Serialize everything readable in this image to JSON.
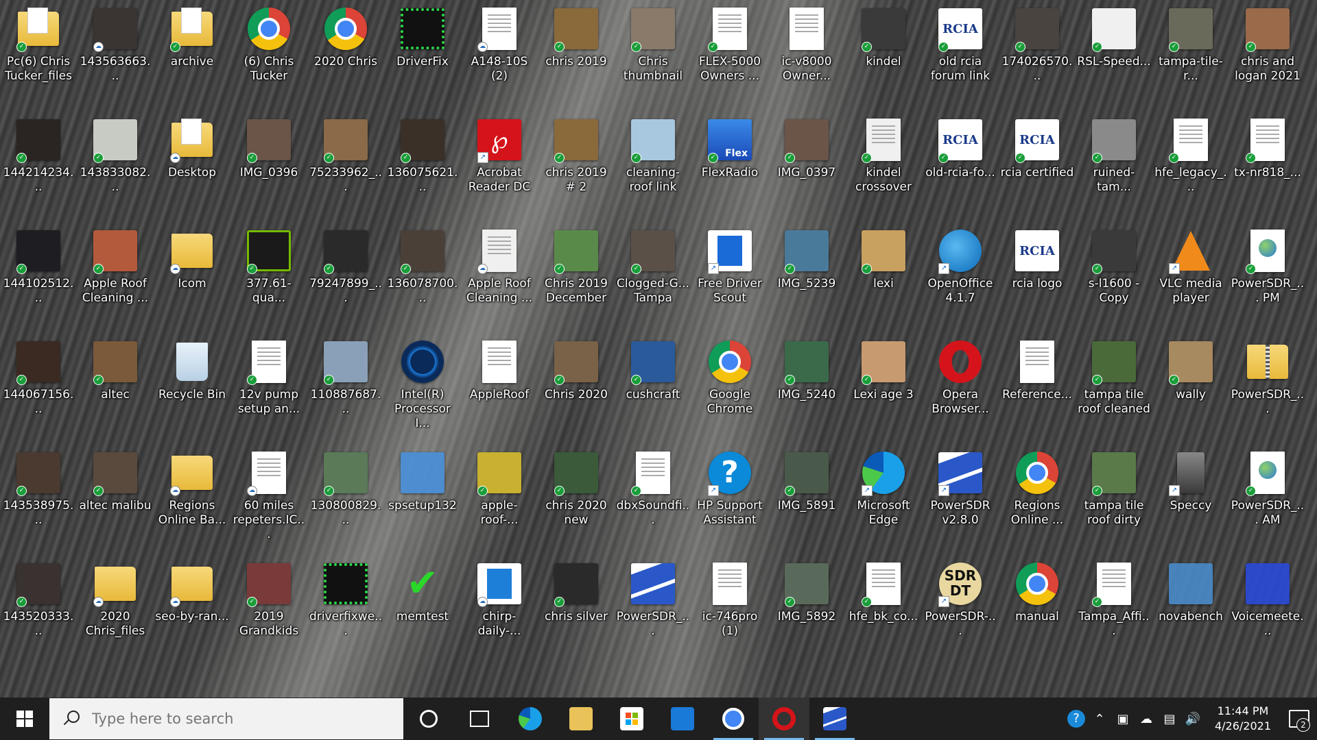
{
  "colors": {
    "taskbar": "#1f1f1f",
    "search_bg": "#f2f2f2",
    "sync_green": "#1a9e3a",
    "active_indicator": "#76b9ed"
  },
  "desktop": {
    "icons": [
      {
        "label": "Pc(6) Chris Tucker_files",
        "kind": "folder-doc",
        "color": "#e9c25a",
        "badge": "sync"
      },
      {
        "label": "144214234...",
        "kind": "photo",
        "color": "#2a2522",
        "badge": "sync"
      },
      {
        "label": "144102512...",
        "kind": "photo",
        "color": "#1e1e22",
        "badge": "sync"
      },
      {
        "label": "144067156...",
        "kind": "photo",
        "color": "#3a2a22",
        "badge": "sync"
      },
      {
        "label": "143538975...",
        "kind": "photo",
        "color": "#4a3a30",
        "badge": "sync"
      },
      {
        "label": "143520333...",
        "kind": "photo",
        "color": "#3a3230",
        "badge": "sync"
      },
      {
        "label": "143563663...",
        "kind": "photo",
        "color": "#3a3433",
        "badge": "cloud"
      },
      {
        "label": "143833082...",
        "kind": "photo",
        "color": "#c8cbc4",
        "badge": "sync"
      },
      {
        "label": "Apple Roof Cleaning ...",
        "kind": "photo",
        "color": "#b45a3c",
        "badge": "sync"
      },
      {
        "label": "altec",
        "kind": "photo",
        "color": "#7a5a3a",
        "badge": "sync"
      },
      {
        "label": "altec malibu",
        "kind": "photo",
        "color": "#5a4a3e",
        "badge": "sync"
      },
      {
        "label": "2020 Chris_files",
        "kind": "folder",
        "color": "#e9c25a",
        "badge": "cloud"
      },
      {
        "label": "archive",
        "kind": "folder-doc",
        "color": "#e9c25a",
        "badge": "sync"
      },
      {
        "label": "Desktop",
        "kind": "folder-doc",
        "color": "#e9c25a",
        "badge": "cloud"
      },
      {
        "label": "Icom",
        "kind": "folder",
        "color": "#e9c25a",
        "badge": "cloud"
      },
      {
        "label": "Recycle Bin",
        "kind": "bin",
        "color": "#d8e6f0",
        "badge": ""
      },
      {
        "label": "Regions Online Ba...",
        "kind": "folder",
        "color": "#e9c25a",
        "badge": "cloud"
      },
      {
        "label": "seo-by-ran...",
        "kind": "folder",
        "color": "#e9c25a",
        "badge": "cloud"
      },
      {
        "label": "(6) Chris Tucker",
        "kind": "chrome",
        "color": "#4285f4",
        "badge": ""
      },
      {
        "label": "IMG_0396",
        "kind": "photo",
        "color": "#6a5548",
        "badge": "sync"
      },
      {
        "label": "377.61-qua...",
        "kind": "nvidia",
        "color": "#76b900",
        "badge": "sync"
      },
      {
        "label": "12v pump setup an...",
        "kind": "doc",
        "color": "#ffffff",
        "badge": "sync"
      },
      {
        "label": "60 miles repeters.IC...",
        "kind": "doc",
        "color": "#ffffff",
        "badge": "cloud"
      },
      {
        "label": "2019 Grandkids",
        "kind": "photo",
        "color": "#7a3a3a",
        "badge": "sync"
      },
      {
        "label": "2020 Chris",
        "kind": "chrome",
        "color": "#4285f4",
        "badge": ""
      },
      {
        "label": "75233962_...",
        "kind": "photo",
        "color": "#8a6a48",
        "badge": "sync"
      },
      {
        "label": "79247899_...",
        "kind": "photo",
        "color": "#2a2a2a",
        "badge": "sync"
      },
      {
        "label": "110887687...",
        "kind": "photo",
        "color": "#8aa0b8",
        "badge": "sync"
      },
      {
        "label": "130800829...",
        "kind": "photo",
        "color": "#5a7a58",
        "badge": "sync"
      },
      {
        "label": "driverfixwe...",
        "kind": "driverfix",
        "color": "#1a1a1a",
        "badge": ""
      },
      {
        "label": "DriverFix",
        "kind": "driverfix",
        "color": "#111111",
        "badge": ""
      },
      {
        "label": "136075621...",
        "kind": "photo",
        "color": "#3a3028",
        "badge": "sync"
      },
      {
        "label": "136078700...",
        "kind": "photo",
        "color": "#4a4038",
        "badge": "sync"
      },
      {
        "label": "Intel(R) Processor I...",
        "kind": "intel",
        "color": "#0a2a5a",
        "badge": ""
      },
      {
        "label": "spsetup132",
        "kind": "setup",
        "color": "#4a90d9",
        "badge": ""
      },
      {
        "label": "memtest",
        "kind": "memtest",
        "color": "#2a8a2a",
        "badge": ""
      },
      {
        "label": "A148-10S (2)",
        "kind": "doc",
        "color": "#ffffff",
        "badge": "cloud"
      },
      {
        "label": "Acrobat Reader DC",
        "kind": "acrobat",
        "color": "#d4141a",
        "badge": "shortcut"
      },
      {
        "label": "Apple Roof Cleaning ...",
        "kind": "doc",
        "color": "#f0f0f0",
        "badge": "cloud"
      },
      {
        "label": "AppleRoof",
        "kind": "doc",
        "color": "#ffffff",
        "badge": ""
      },
      {
        "label": "apple-roof-...",
        "kind": "photo",
        "color": "#c8b030",
        "badge": "sync"
      },
      {
        "label": "chirp-daily-...",
        "kind": "app",
        "color": "#1e7fd8",
        "badge": "cloud"
      },
      {
        "label": "chris 2019",
        "kind": "photo",
        "color": "#8a6a3a",
        "badge": "sync"
      },
      {
        "label": "chris 2019 # 2",
        "kind": "photo",
        "color": "#8a6a3a",
        "badge": "sync"
      },
      {
        "label": "Chris 2019 December",
        "kind": "photo",
        "color": "#5a8a4a",
        "badge": "sync"
      },
      {
        "label": "Chris 2020",
        "kind": "photo",
        "color": "#7a6248",
        "badge": "sync"
      },
      {
        "label": "chris 2020 new",
        "kind": "photo",
        "color": "#3a5a3a",
        "badge": "sync"
      },
      {
        "label": "chris silver",
        "kind": "photo",
        "color": "#2a2a2a",
        "badge": "sync"
      },
      {
        "label": "Chris thumbnail",
        "kind": "photo",
        "color": "#8a7a6a",
        "badge": "sync"
      },
      {
        "label": "cleaning-roof link",
        "kind": "photo",
        "color": "#a8c8e0",
        "badge": "sync"
      },
      {
        "label": "Clogged-G... Tampa",
        "kind": "photo",
        "color": "#5a5048",
        "badge": "sync"
      },
      {
        "label": "cushcraft",
        "kind": "photo",
        "color": "#2a5a9a",
        "badge": "sync"
      },
      {
        "label": "dbxSoundfi...",
        "kind": "doc",
        "color": "#ffffff",
        "badge": "sync"
      },
      {
        "label": "PowerSDR_...",
        "kind": "powersdr",
        "color": "#2a58c8",
        "badge": ""
      },
      {
        "label": "FLEX-5000 Owners ...",
        "kind": "doc",
        "color": "#ffffff",
        "badge": "sync"
      },
      {
        "label": "FlexRadio",
        "kind": "flex",
        "color": "#1a5ab8",
        "badge": "sync"
      },
      {
        "label": "Free Driver Scout",
        "kind": "app",
        "color": "#1a6ad8",
        "badge": "shortcut"
      },
      {
        "label": "Google Chrome",
        "kind": "chrome",
        "color": "#4285f4",
        "badge": ""
      },
      {
        "label": "HP Support Assistant",
        "kind": "hp",
        "color": "#0a8ad8",
        "badge": "shortcut"
      },
      {
        "label": "ic-746pro (1)",
        "kind": "doc",
        "color": "#ffffff",
        "badge": ""
      },
      {
        "label": "ic-v8000 Owner...",
        "kind": "doc",
        "color": "#ffffff",
        "badge": ""
      },
      {
        "label": "IMG_0397",
        "kind": "photo",
        "color": "#6a5548",
        "badge": "sync"
      },
      {
        "label": "IMG_5239",
        "kind": "photo",
        "color": "#4a7a9a",
        "badge": "sync"
      },
      {
        "label": "IMG_5240",
        "kind": "photo",
        "color": "#3a6a4a",
        "badge": "sync"
      },
      {
        "label": "IMG_5891",
        "kind": "photo",
        "color": "#4a5a4a",
        "badge": "sync"
      },
      {
        "label": "IMG_5892",
        "kind": "photo",
        "color": "#5a6a5a",
        "badge": "sync"
      },
      {
        "label": "kindel",
        "kind": "photo",
        "color": "#3a3a3a",
        "badge": "sync"
      },
      {
        "label": "kindel crossover",
        "kind": "doc",
        "color": "#f0f0f0",
        "badge": "sync"
      },
      {
        "label": "lexi",
        "kind": "photo",
        "color": "#c8a060",
        "badge": "sync"
      },
      {
        "label": "Lexi age 3",
        "kind": "photo",
        "color": "#c89a70",
        "badge": "sync"
      },
      {
        "label": "Microsoft Edge",
        "kind": "edge",
        "color": "#1a8ad8",
        "badge": "shortcut"
      },
      {
        "label": "hfe_bk_co...",
        "kind": "doc",
        "color": "#ffffff",
        "badge": "sync"
      },
      {
        "label": "old rcia forum link",
        "kind": "rcia",
        "color": "#ffffff",
        "badge": "sync"
      },
      {
        "label": "old-rcia-fo...",
        "kind": "rcia",
        "color": "#ffffff",
        "badge": "sync"
      },
      {
        "label": "OpenOffice 4.1.7",
        "kind": "openoffice",
        "color": "#1a8ad8",
        "badge": "shortcut"
      },
      {
        "label": "Opera Browser...",
        "kind": "opera",
        "color": "#d4141a",
        "badge": ""
      },
      {
        "label": "PowerSDR v2.8.0",
        "kind": "powersdr",
        "color": "#2a58c8",
        "badge": "shortcut"
      },
      {
        "label": "PowerSDR-...",
        "kind": "sdrdt",
        "color": "#e8d8a0",
        "badge": "shortcut"
      },
      {
        "label": "174026570...",
        "kind": "photo",
        "color": "#4a4440",
        "badge": "sync"
      },
      {
        "label": "rcia certified",
        "kind": "rcia",
        "color": "#ffffff",
        "badge": "sync"
      },
      {
        "label": "rcia logo",
        "kind": "rcia",
        "color": "#ffffff",
        "badge": ""
      },
      {
        "label": "Reference...",
        "kind": "doc",
        "color": "#ffffff",
        "badge": ""
      },
      {
        "label": "Regions Online ...",
        "kind": "chrome",
        "color": "#4285f4",
        "badge": ""
      },
      {
        "label": "manual",
        "kind": "chrome",
        "color": "#4285f4",
        "badge": ""
      },
      {
        "label": "RSL-Speed...",
        "kind": "photo",
        "color": "#f0f0f0",
        "badge": "sync"
      },
      {
        "label": "ruined-tam...",
        "kind": "photo",
        "color": "#8a8a8a",
        "badge": "sync"
      },
      {
        "label": "s-l1600 - Copy",
        "kind": "photo",
        "color": "#3a3a3a",
        "badge": "sync"
      },
      {
        "label": "tampa tile roof cleaned",
        "kind": "photo",
        "color": "#4a6a3a",
        "badge": "sync"
      },
      {
        "label": "tampa tile roof dirty",
        "kind": "photo",
        "color": "#5a7a4a",
        "badge": "sync"
      },
      {
        "label": "Tampa_Affi...",
        "kind": "doc",
        "color": "#ffffff",
        "badge": "sync"
      },
      {
        "label": "tampa-tile-r...",
        "kind": "photo",
        "color": "#6a6a5a",
        "badge": "sync"
      },
      {
        "label": "hfe_legacy_...",
        "kind": "doc",
        "color": "#ffffff",
        "badge": "sync"
      },
      {
        "label": "VLC media player",
        "kind": "vlc",
        "color": "#f08a1a",
        "badge": "shortcut"
      },
      {
        "label": "wally",
        "kind": "photo",
        "color": "#a88a60",
        "badge": "sync"
      },
      {
        "label": "Speccy",
        "kind": "speccy",
        "color": "#5a5a5a",
        "badge": "shortcut"
      },
      {
        "label": "novabench",
        "kind": "setup",
        "color": "#4a8ac8",
        "badge": ""
      },
      {
        "label": "chris and logan 2021",
        "kind": "photo",
        "color": "#9a6a4a",
        "badge": "sync"
      },
      {
        "label": "tx-nr818_...",
        "kind": "doc",
        "color": "#ffffff",
        "badge": "sync"
      },
      {
        "label": "PowerSDR_... PM",
        "kind": "doc-globe",
        "color": "#ffffff",
        "badge": "sync"
      },
      {
        "label": "PowerSDR_...",
        "kind": "folder-zip",
        "color": "#e9c25a",
        "badge": ""
      },
      {
        "label": "PowerSDR_... AM",
        "kind": "doc-globe",
        "color": "#ffffff",
        "badge": "sync"
      },
      {
        "label": "Voicemeete...",
        "kind": "setup",
        "color": "#2a4ad8",
        "badge": ""
      }
    ]
  },
  "taskbar": {
    "search_placeholder": "Type here to search",
    "pinned": [
      {
        "name": "edge",
        "color": "#1a8ad8",
        "active": false
      },
      {
        "name": "file-explorer",
        "color": "#e9c25a",
        "active": false
      },
      {
        "name": "microsoft-store",
        "color": "#3a3a3a",
        "active": false
      },
      {
        "name": "mail",
        "color": "#1a7ad8",
        "active": false
      },
      {
        "name": "chrome",
        "color": "#4285f4",
        "active": true
      },
      {
        "name": "opera",
        "color": "#d4141a",
        "active": true
      },
      {
        "name": "powersdr",
        "color": "#2a58c8",
        "active": true
      }
    ],
    "clock_time": "11:44 PM",
    "clock_date": "4/26/2021",
    "notification_count": "2"
  }
}
